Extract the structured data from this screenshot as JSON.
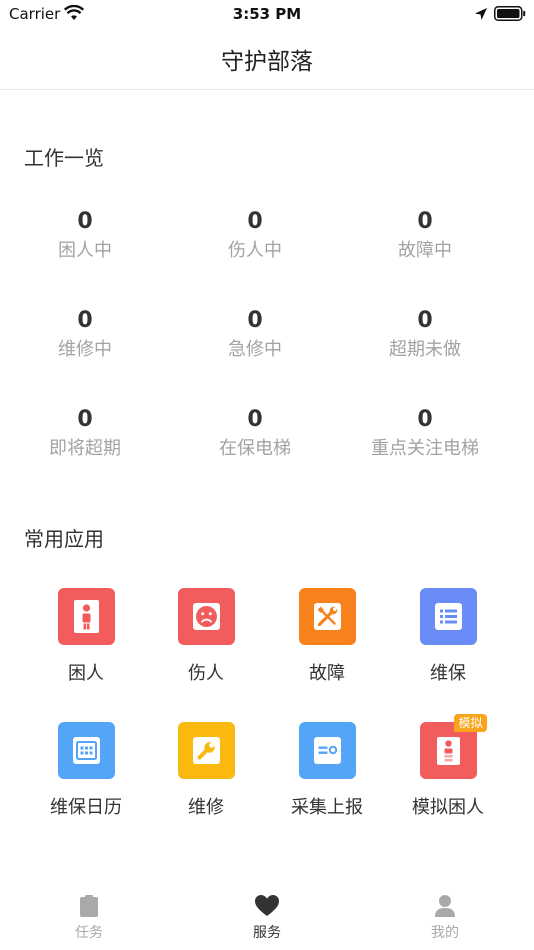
{
  "status_bar": {
    "carrier": "Carrier",
    "time": "3:53 PM"
  },
  "nav": {
    "title": "守护部落"
  },
  "overview": {
    "title": "工作一览",
    "stats": [
      {
        "value": "0",
        "label": "困人中"
      },
      {
        "value": "0",
        "label": "伤人中"
      },
      {
        "value": "0",
        "label": "故障中"
      },
      {
        "value": "0",
        "label": "维修中"
      },
      {
        "value": "0",
        "label": "急修中"
      },
      {
        "value": "0",
        "label": "超期未做"
      },
      {
        "value": "0",
        "label": "即将超期"
      },
      {
        "value": "0",
        "label": "在保电梯"
      },
      {
        "value": "0",
        "label": "重点关注电梯"
      }
    ]
  },
  "apps": {
    "title": "常用应用",
    "items": [
      {
        "label": "困人",
        "icon": "trapped-person-icon",
        "color": "#f25c5c"
      },
      {
        "label": "伤人",
        "icon": "sad-face-icon",
        "color": "#f25c5c"
      },
      {
        "label": "故障",
        "icon": "tools-icon",
        "color": "#f7821b"
      },
      {
        "label": "维保",
        "icon": "list-icon",
        "color": "#6a8cf7"
      },
      {
        "label": "维保日历",
        "icon": "calendar-icon",
        "color": "#54a4f7"
      },
      {
        "label": "维修",
        "icon": "wrench-icon",
        "color": "#f9b90f"
      },
      {
        "label": "采集上报",
        "icon": "card-icon",
        "color": "#54a4f7"
      },
      {
        "label": "模拟困人",
        "icon": "simulate-icon",
        "color": "#f25c5c",
        "badge": "模拟"
      }
    ]
  },
  "tabbar": {
    "items": [
      {
        "label": "任务",
        "icon": "clipboard-icon",
        "active": false
      },
      {
        "label": "服务",
        "icon": "heart-icon",
        "active": true
      },
      {
        "label": "我的",
        "icon": "person-icon",
        "active": false
      }
    ],
    "active_color": "#333333",
    "inactive_color": "#a9a9a9"
  }
}
